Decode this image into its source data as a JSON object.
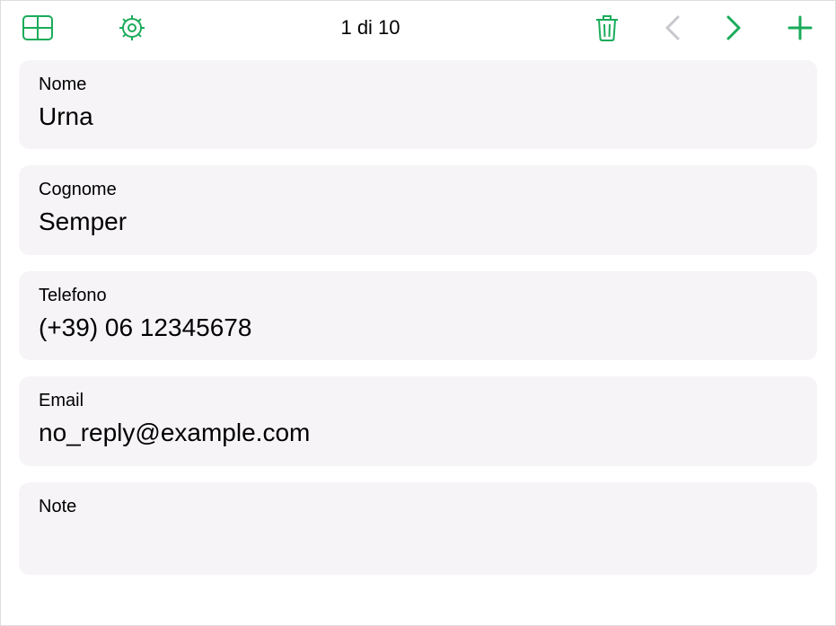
{
  "toolbar": {
    "counter": "1 di 10",
    "icons": {
      "table": "table-icon",
      "gear": "gear-icon",
      "trash": "trash-icon",
      "prev": "chevron-left-icon",
      "next": "chevron-right-icon",
      "add": "plus-icon"
    }
  },
  "fields": [
    {
      "label": "Nome",
      "value": "Urna"
    },
    {
      "label": "Cognome",
      "value": "Semper"
    },
    {
      "label": "Telefono",
      "value": "(+39) 06 12345678"
    },
    {
      "label": "Email",
      "value": "no_reply@example.com"
    },
    {
      "label": "Note",
      "value": ""
    }
  ]
}
